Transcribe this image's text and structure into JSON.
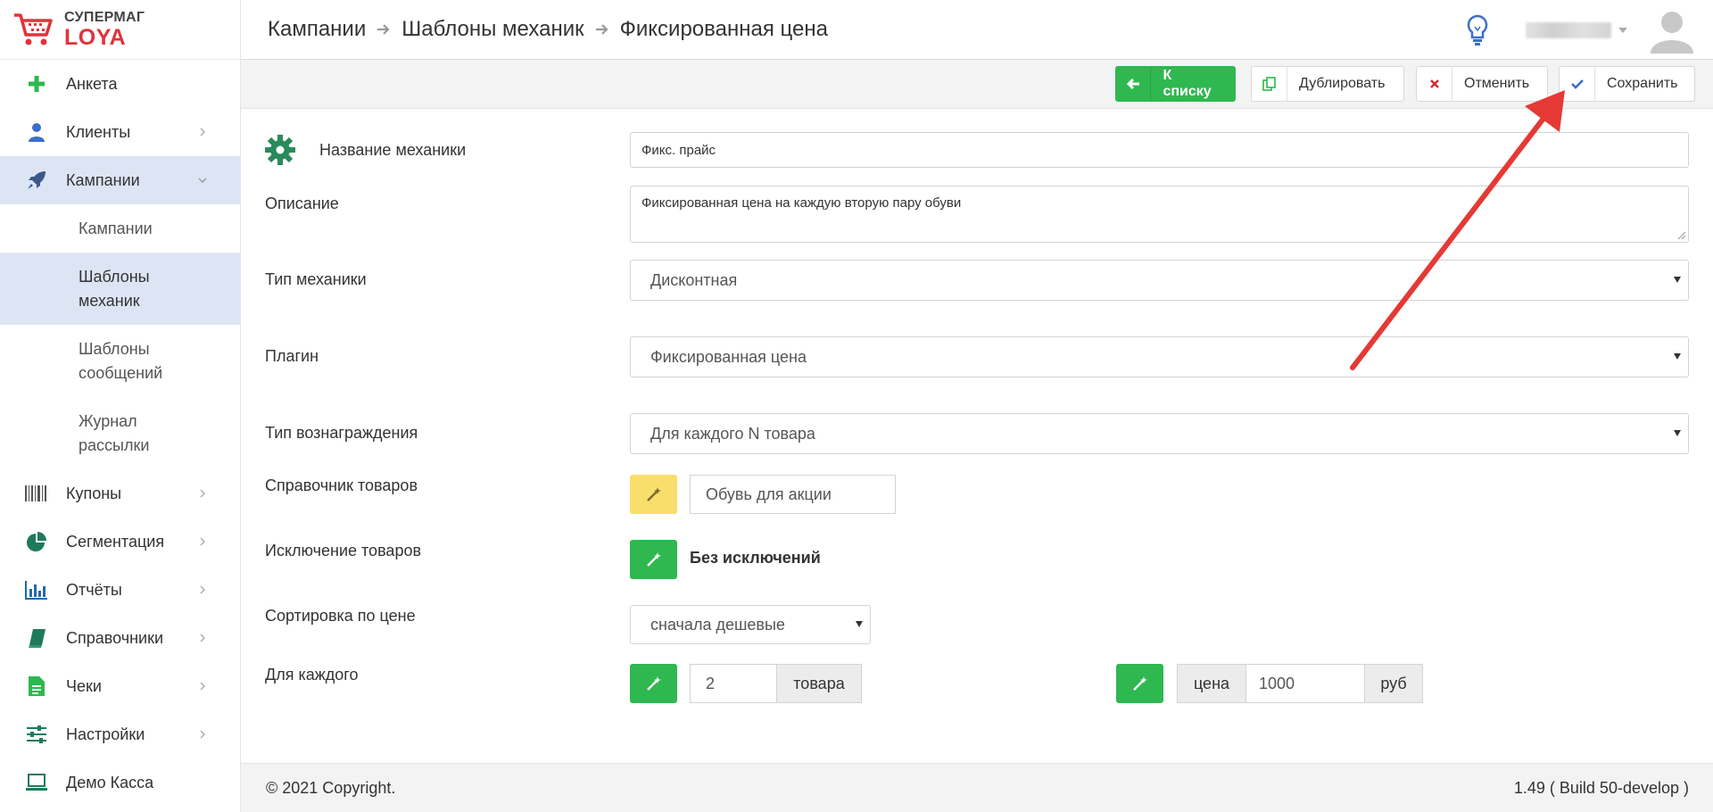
{
  "brand": {
    "top": "СУПЕРМАГ",
    "bottom": "LOYA",
    "accent": "#e0343a"
  },
  "sidebar": {
    "items": [
      {
        "label": "Анкета",
        "icon": "plus-icon"
      },
      {
        "label": "Клиенты",
        "icon": "user-icon"
      },
      {
        "label": "Кампании",
        "icon": "rocket-icon",
        "expanded": true
      },
      {
        "label": "Купоны",
        "icon": "barcode-icon"
      },
      {
        "label": "Сегментация",
        "icon": "pie-chart-icon"
      },
      {
        "label": "Отчёты",
        "icon": "bar-chart-icon"
      },
      {
        "label": "Справочники",
        "icon": "book-icon"
      },
      {
        "label": "Чеки",
        "icon": "document-icon"
      },
      {
        "label": "Настройки",
        "icon": "sliders-icon"
      },
      {
        "label": "Демо Касса",
        "icon": "laptop-icon"
      }
    ],
    "sub_items": [
      {
        "label": "Кампании"
      },
      {
        "label": "Шаблоны механик",
        "active": true
      },
      {
        "label": "Шаблоны сообщений"
      },
      {
        "label": "Журнал рассылки"
      }
    ]
  },
  "breadcrumb": [
    "Кампании",
    "Шаблоны механик",
    "Фиксированная цена"
  ],
  "toolbar": {
    "back_label": "К списку",
    "duplicate_label": "Дублировать",
    "cancel_label": "Отменить",
    "save_label": "Сохранить"
  },
  "form": {
    "name_label": "Название механики",
    "name_value": "Фикс. прайс",
    "description_label": "Описание",
    "description_value": "Фиксированная цена на каждую вторую пару обуви",
    "type_label": "Тип механики",
    "type_value": "Дисконтная",
    "plugin_label": "Плагин",
    "plugin_value": "Фиксированная цена",
    "reward_label": "Тип вознаграждения",
    "reward_value": "Для каждого N товара",
    "catalog_label": "Справочник товаров",
    "catalog_value": "Обувь для акции",
    "exclusion_label": "Исключение товаров",
    "exclusion_value": "Без исключений",
    "sort_label": "Сортировка по цене",
    "sort_value": "сначала дешевые",
    "each_label": "Для каждого",
    "each_value": "2",
    "each_unit": "товара",
    "price_prefix": "цена",
    "price_value": "1000",
    "price_unit": "руб"
  },
  "footer": {
    "copyright": "© 2021 Copyright.",
    "version": "1.49 ( Build 50-develop )"
  },
  "colors": {
    "green": "#2eb84f",
    "yellow": "#f8df6c",
    "active_bg": "#dde5f4",
    "arrow": "#e53935"
  }
}
